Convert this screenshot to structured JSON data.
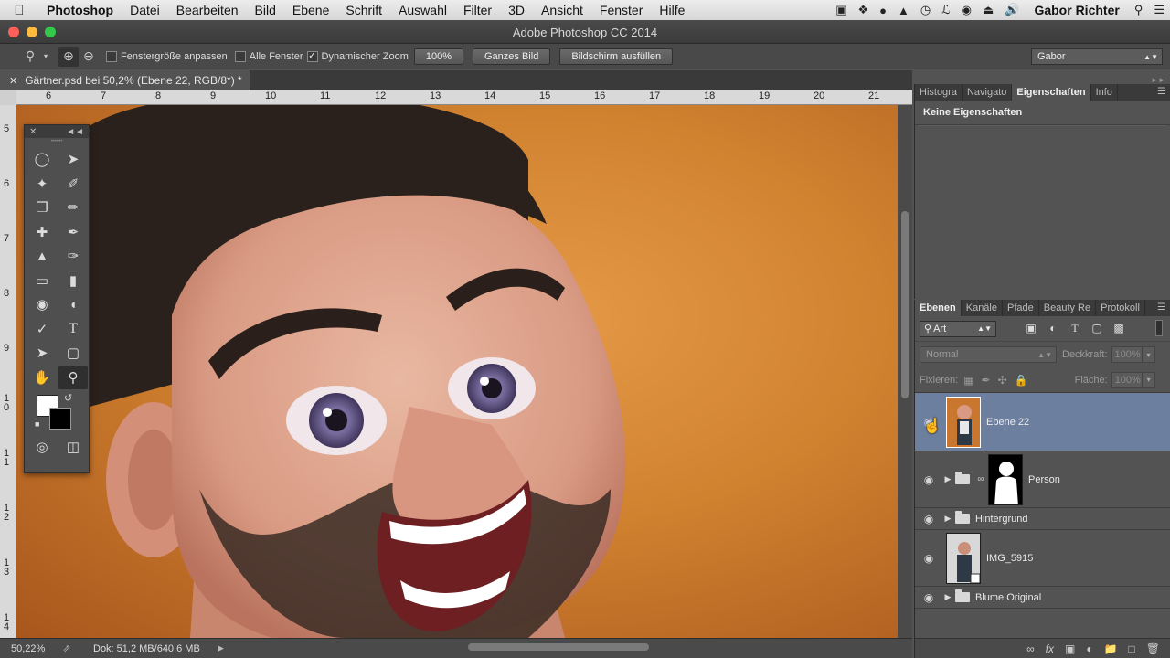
{
  "menubar": {
    "app": "Photoshop",
    "items": [
      "Datei",
      "Bearbeiten",
      "Bild",
      "Ebene",
      "Schrift",
      "Auswahl",
      "Filter",
      "3D",
      "Ansicht",
      "Fenster",
      "Hilfe"
    ],
    "user": "Gabor Richter"
  },
  "window": {
    "title": "Adobe Photoshop CC 2014"
  },
  "options": {
    "fit_window": "Fenstergröße anpassen",
    "all_windows": "Alle Fenster",
    "dynamic_zoom": "Dynamischer Zoom",
    "zoom_100": "100%",
    "fit_screen": "Ganzes Bild",
    "fill_screen": "Bildschirm ausfüllen",
    "workspace": "Gabor"
  },
  "document": {
    "tab_title": "Gärtner.psd bei 50,2% (Ebene 22, RGB/8*) *"
  },
  "rulers": {
    "horizontal": [
      "6",
      "7",
      "8",
      "9",
      "10",
      "11",
      "12",
      "13",
      "14",
      "15",
      "16",
      "17",
      "18",
      "19",
      "20",
      "21"
    ],
    "vertical": [
      "5",
      "6",
      "7",
      "8",
      "9",
      "1\n0",
      "1\n1",
      "1\n2",
      "1\n3",
      "1\n4"
    ]
  },
  "status": {
    "zoom": "50,22%",
    "doc": "Dok: 51,2 MB/640,6 MB"
  },
  "properties_panel": {
    "tabs": [
      "Histogra",
      "Navigato",
      "Eigenschaften",
      "Info"
    ],
    "active_tab": "Eigenschaften",
    "message": "Keine Eigenschaften"
  },
  "layers_panel": {
    "tabs": [
      "Ebenen",
      "Kanäle",
      "Pfade",
      "Beauty Re",
      "Protokoll"
    ],
    "kind": "Art",
    "blend_mode": "Normal",
    "opacity_label": "Deckkraft:",
    "opacity": "100%",
    "lock_label": "Fixieren:",
    "fill_label": "Fläche:",
    "fill": "100%",
    "layers": [
      {
        "name": "Ebene 22",
        "selected": true
      },
      {
        "name": "Person",
        "selected": false
      },
      {
        "name": "Hintergrund",
        "selected": false
      },
      {
        "name": "IMG_5915",
        "selected": false
      },
      {
        "name": "Blume Original",
        "selected": false
      }
    ]
  }
}
